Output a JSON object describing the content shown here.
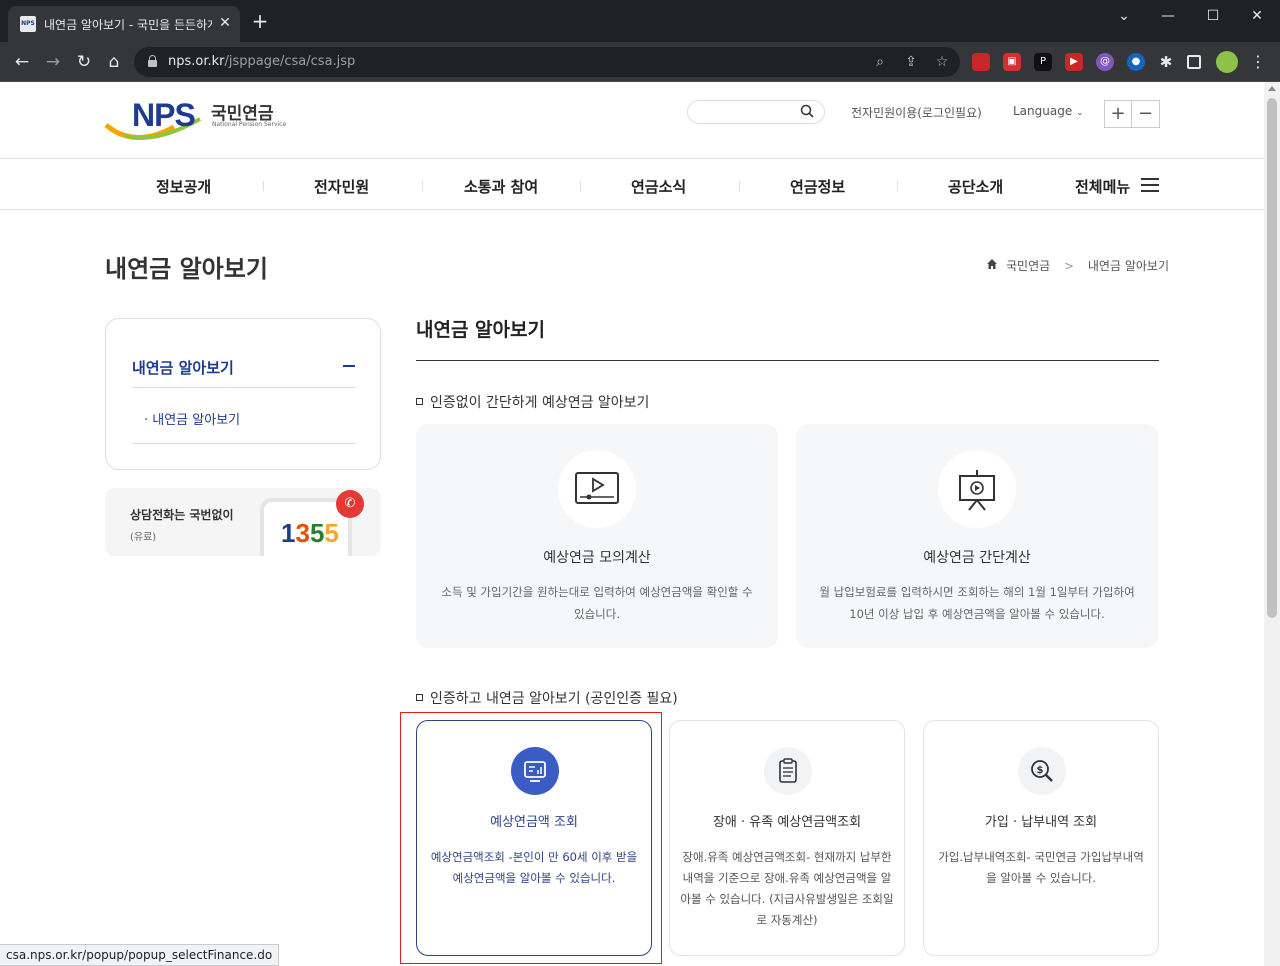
{
  "browser": {
    "tab_title": "내연금 알아보기 - 국민을 든든하게",
    "url_domain": "nps.or.kr",
    "url_path": "/jsppage/csa/csa.jsp",
    "status_url": "csa.nps.or.kr/popup/popup_selectFinance.do"
  },
  "header": {
    "logo_text": "NPS",
    "logo_kr": "국민연금",
    "logo_en": "National Pension Service",
    "civil_link": "전자민원이용(로그인필요)",
    "language": "Language",
    "zoom_in": "+",
    "zoom_out": "−"
  },
  "gnb": {
    "items": [
      "정보공개",
      "전자민원",
      "소통과 참여",
      "연금소식",
      "연금정보",
      "공단소개"
    ],
    "all_menu": "전체메뉴"
  },
  "page": {
    "title": "내연금 알아보기",
    "breadcrumb_home": "국민연금",
    "breadcrumb_sep": ">",
    "breadcrumb_current": "내연금 알아보기"
  },
  "lnb": {
    "title": "내연금 알아보기",
    "sub_item": "· 내연금 알아보기"
  },
  "call": {
    "line1": "상담전화는 국번없이",
    "line2": "(유료)",
    "number_1": "1",
    "number_2": "3",
    "number_3": "5",
    "number_4": "5"
  },
  "content": {
    "section_title": "내연금 알아보기",
    "subhead1": "인증없이 간단하게 예상연금 알아보기",
    "subhead2": "인증하고 내연금 알아보기 (공인인증 필요)",
    "cards_big": [
      {
        "title": "예상연금 모의계산",
        "desc": "소득 및 가입기간을 원하는대로 입력하여 예상연금액을 확인할 수 있습니다."
      },
      {
        "title": "예상연금 간단계산",
        "desc": "월 납입보험료를 입력하시면 조회하는 해의 1월 1일부터 가입하여 10년 이상 납입 후 예상연금액을 알아볼 수 있습니다."
      }
    ],
    "cards_small": [
      {
        "title": "예상연금액 조회",
        "desc": "예상연금액조회 -본인이 만 60세 이후 받을 예상연금액을 알아볼 수 있습니다."
      },
      {
        "title": "장애 · 유족 예상연금액조회",
        "desc": "장애.유족 예상연금액조회- 현재까지 납부한 내역을 기준으로 장애.유족 예상연금액을 알아볼 수 있습니다. (지급사유발생일은 조회일로 자동계산)"
      },
      {
        "title": "가입 · 납부내역 조회",
        "desc": "가입.납부내역조회- 국민연금 가입납부내역을 알아볼 수 있습니다."
      }
    ]
  },
  "colors": {
    "brand_blue": "#1f3b8f",
    "active_icon": "#3b5cc4",
    "highlight": "#e02020"
  }
}
